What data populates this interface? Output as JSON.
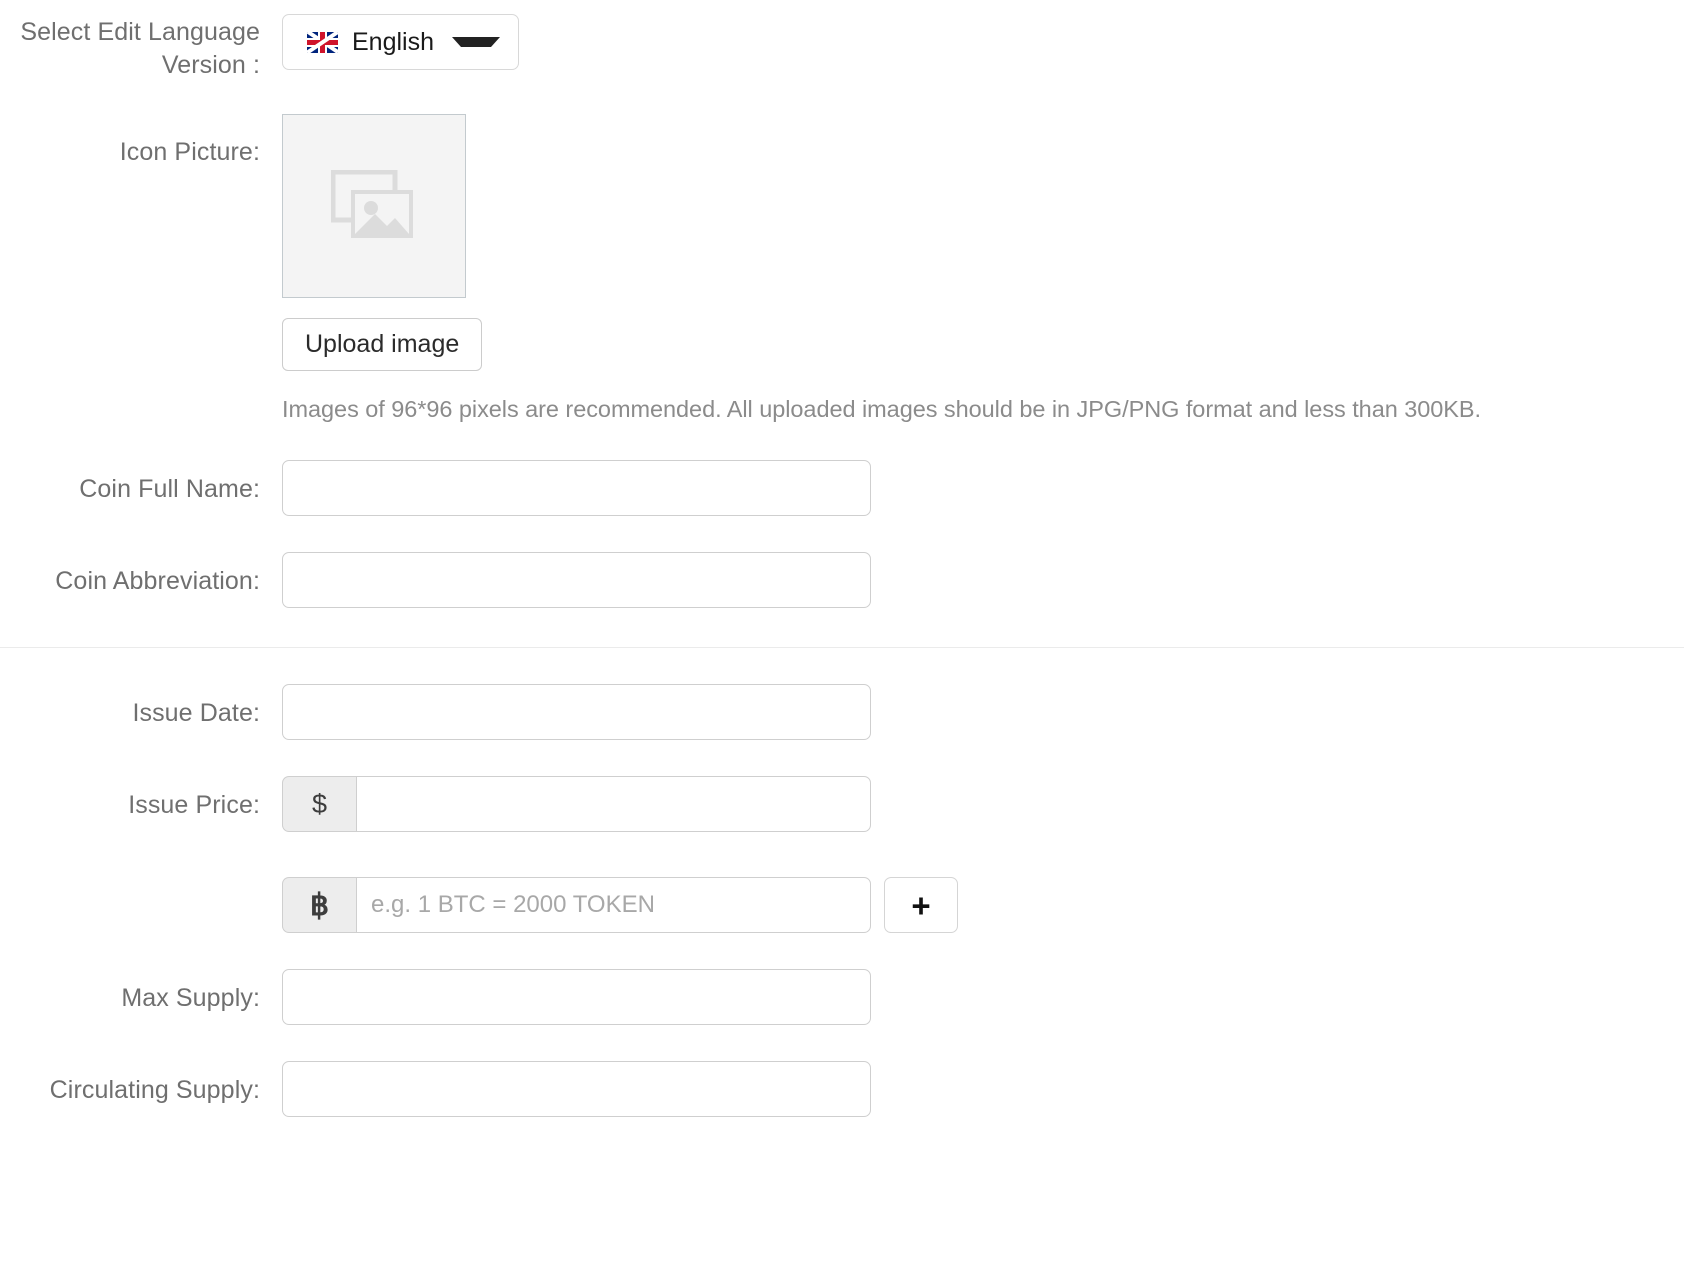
{
  "form": {
    "language_row": {
      "label": "Select Edit Language Version :",
      "selected_language": "English",
      "flag_icon": "uk-flag-icon",
      "caret_icon": "chevron-down-icon"
    },
    "icon_picture_row": {
      "label": "Icon Picture:",
      "placeholder_icon": "image-placeholder-icon",
      "upload_button": "Upload image",
      "hint": "Images of 96*96 pixels are recommended. All uploaded images should be in JPG/PNG format and less than 300KB."
    },
    "coin_full_name": {
      "label": "Coin Full Name:",
      "value": "",
      "placeholder": ""
    },
    "coin_abbreviation": {
      "label": "Coin Abbreviation:",
      "value": "",
      "placeholder": ""
    },
    "issue_date": {
      "label": "Issue Date:",
      "value": "",
      "placeholder": ""
    },
    "issue_price": {
      "label": "Issue Price:",
      "currency_addon": "$",
      "value": "",
      "placeholder": ""
    },
    "issue_rate": {
      "currency_addon": "฿",
      "value": "",
      "placeholder": "e.g. 1 BTC = 2000 TOKEN",
      "add_button": "+"
    },
    "max_supply": {
      "label": "Max Supply:",
      "value": "",
      "placeholder": ""
    },
    "circulating_supply": {
      "label": "Circulating Supply:",
      "value": "",
      "placeholder": ""
    }
  },
  "colors": {
    "label_text": "#6f6f6f",
    "hint_text": "#8b8b8b",
    "input_border": "#cfcfcf",
    "addon_bg": "#ededed",
    "thumb_bg": "#f4f4f4",
    "flag_blue": "#00247d",
    "flag_red": "#cf142b"
  }
}
